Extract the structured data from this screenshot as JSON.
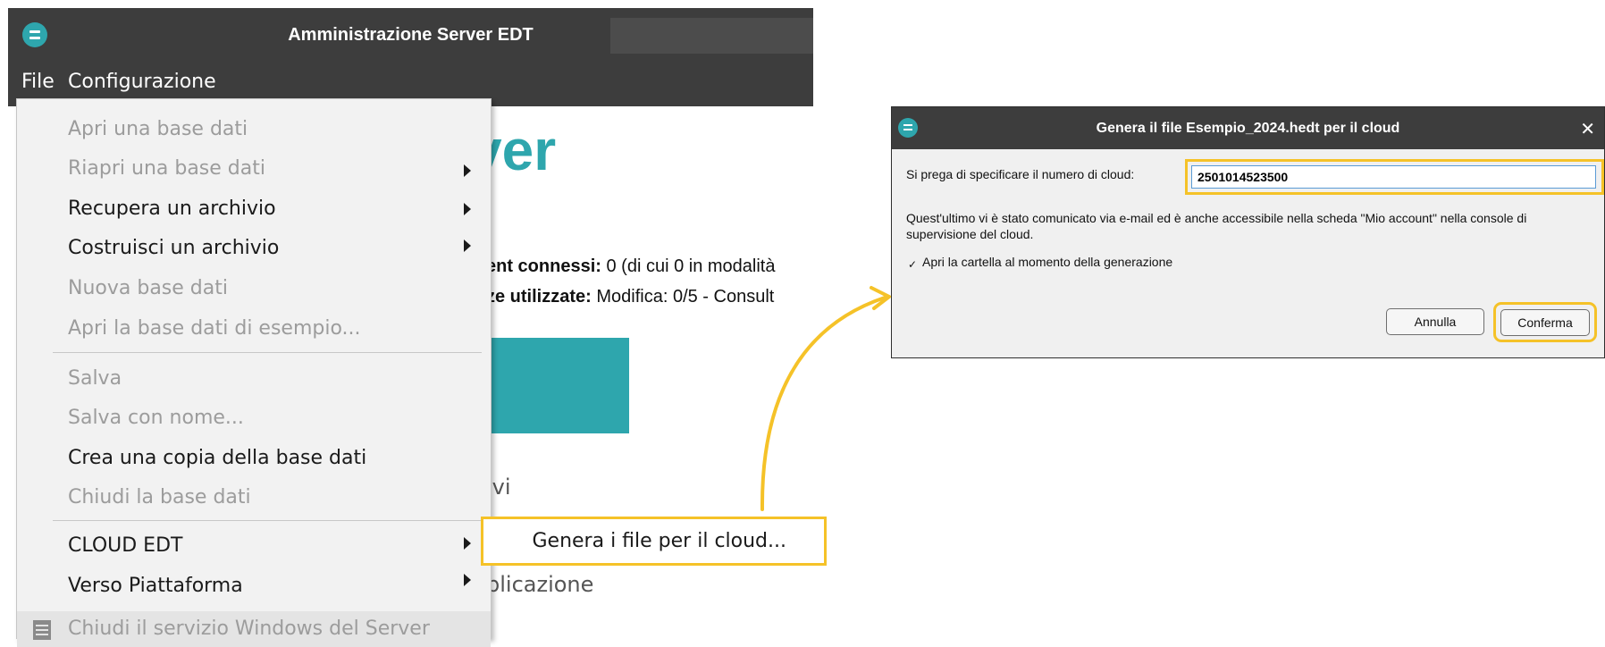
{
  "colors": {
    "accent": "#f5c228",
    "brand": "#2ea6ad",
    "titlebar": "#3d3d3d"
  },
  "app": {
    "title": "Amministrazione Server EDT",
    "icon": "server-logo-icon",
    "menubar": [
      "File",
      "Configurazione"
    ]
  },
  "background": {
    "heading_fragment": "ver",
    "pipe": "|",
    "stat1_bold": "ent connessi:",
    "stat1_rest": " 0 (di cui 0 in modalità",
    "stat2_bold": "ze utilizzate:",
    "stat2_rest": " Modifica: 0/5 - Consult",
    "archivi": "ivi",
    "applicazione": "plicazione"
  },
  "file_menu": {
    "items": [
      {
        "label": "Apri una base dati",
        "enabled": false,
        "submenu": false
      },
      {
        "label": "Riapri una base dati",
        "enabled": false,
        "submenu": true
      },
      {
        "label": "Recupera un archivio",
        "enabled": true,
        "submenu": true
      },
      {
        "label": "Costruisci un archivio",
        "enabled": true,
        "submenu": true
      },
      {
        "label": "Nuova base dati",
        "enabled": false,
        "submenu": false
      },
      {
        "label": "Apri la base dati di esempio...",
        "enabled": false,
        "submenu": false
      },
      {
        "label": "Salva",
        "enabled": false,
        "submenu": false
      },
      {
        "label": "Salva con nome...",
        "enabled": false,
        "submenu": false
      },
      {
        "label": "Crea una copia della base dati",
        "enabled": true,
        "submenu": false
      },
      {
        "label": "Chiudi la base dati",
        "enabled": false,
        "submenu": false
      },
      {
        "label": "CLOUD EDT",
        "enabled": true,
        "submenu": true
      },
      {
        "label": "Verso Piattaforma",
        "enabled": true,
        "submenu": true
      },
      {
        "label": "Chiudi il servizio Windows del Server",
        "enabled": false,
        "submenu": false
      }
    ],
    "last_item_icon": "server-icon"
  },
  "cloud_submenu": {
    "item": "Genera i file per il cloud..."
  },
  "dialog": {
    "title": "Genera il file Esempio_2024.hedt per il cloud",
    "icon": "server-logo-icon",
    "close": "✕",
    "cloud_label": "Si prega di specificare il numero di cloud:",
    "cloud_value": "2501014523500",
    "info": "Quest'ultimo vi è stato comunicato via e-mail ed è anche accessibile nella scheda \"Mio account\" nella console di supervisione del cloud.",
    "open_folder_label": "Apri la cartella al momento della generazione",
    "open_folder_checked": true,
    "check_mark": "✓",
    "cancel": "Annulla",
    "confirm": "Conferma"
  }
}
